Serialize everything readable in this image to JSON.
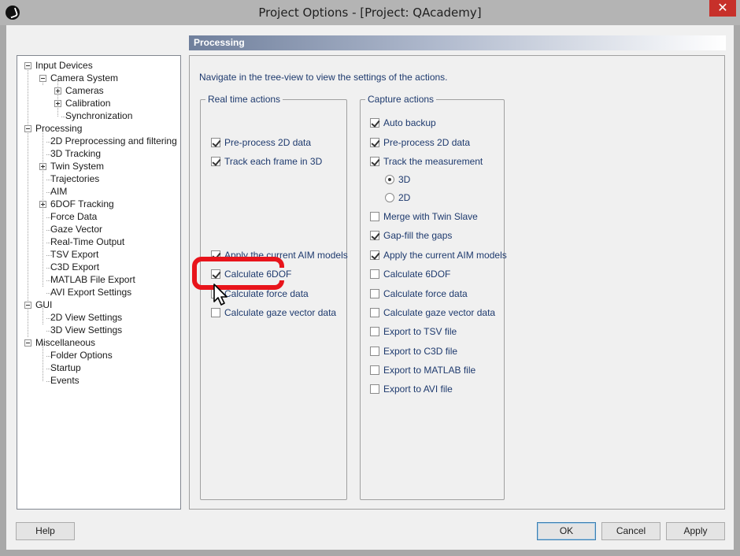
{
  "window": {
    "title": "Project Options - [Project: QAcademy]",
    "close_glyph": "✕"
  },
  "tree": {
    "items": [
      {
        "label": "Input Devices",
        "depth": 0,
        "expander": "minus"
      },
      {
        "label": "Camera System",
        "depth": 1,
        "expander": "minus"
      },
      {
        "label": "Cameras",
        "depth": 2,
        "expander": "plus"
      },
      {
        "label": "Calibration",
        "depth": 2,
        "expander": "plus"
      },
      {
        "label": "Synchronization",
        "depth": 2,
        "expander": "none"
      },
      {
        "label": "Processing",
        "depth": 0,
        "expander": "minus"
      },
      {
        "label": "2D Preprocessing and filtering",
        "depth": 1,
        "expander": "none"
      },
      {
        "label": "3D Tracking",
        "depth": 1,
        "expander": "none"
      },
      {
        "label": "Twin System",
        "depth": 1,
        "expander": "plus"
      },
      {
        "label": "Trajectories",
        "depth": 1,
        "expander": "none"
      },
      {
        "label": "AIM",
        "depth": 1,
        "expander": "none"
      },
      {
        "label": "6DOF Tracking",
        "depth": 1,
        "expander": "plus"
      },
      {
        "label": "Force Data",
        "depth": 1,
        "expander": "none"
      },
      {
        "label": "Gaze Vector",
        "depth": 1,
        "expander": "none"
      },
      {
        "label": "Real-Time Output",
        "depth": 1,
        "expander": "none"
      },
      {
        "label": "TSV Export",
        "depth": 1,
        "expander": "none"
      },
      {
        "label": "C3D Export",
        "depth": 1,
        "expander": "none"
      },
      {
        "label": "MATLAB File Export",
        "depth": 1,
        "expander": "none"
      },
      {
        "label": "AVI Export Settings",
        "depth": 1,
        "expander": "none"
      },
      {
        "label": "GUI",
        "depth": 0,
        "expander": "minus"
      },
      {
        "label": "2D View Settings",
        "depth": 1,
        "expander": "none"
      },
      {
        "label": "3D View Settings",
        "depth": 1,
        "expander": "none"
      },
      {
        "label": "Miscellaneous",
        "depth": 0,
        "expander": "minus"
      },
      {
        "label": "Folder Options",
        "depth": 1,
        "expander": "none"
      },
      {
        "label": "Startup",
        "depth": 1,
        "expander": "none"
      },
      {
        "label": "Events",
        "depth": 1,
        "expander": "none"
      }
    ]
  },
  "panel": {
    "header": "Processing",
    "hint": "Navigate in the tree-view to view the settings of the actions."
  },
  "realtime": {
    "legend": "Real time actions",
    "items": [
      {
        "label": "Pre-process 2D data",
        "checked": true
      },
      {
        "label": "Track each frame in 3D",
        "checked": true
      },
      {
        "label": "Apply the current AIM models",
        "checked": true
      },
      {
        "label": "Calculate 6DOF",
        "checked": true
      },
      {
        "label": "Calculate force data",
        "checked": false
      },
      {
        "label": "Calculate gaze vector data",
        "checked": false
      }
    ]
  },
  "capture": {
    "legend": "Capture actions",
    "items": [
      {
        "label": "Auto backup",
        "checked": true
      },
      {
        "label": "Pre-process 2D data",
        "checked": true
      },
      {
        "label": "Track the measurement",
        "checked": true
      },
      {
        "label": "Merge with Twin Slave",
        "checked": false
      },
      {
        "label": "Gap-fill the gaps",
        "checked": true
      },
      {
        "label": "Apply the current AIM models",
        "checked": true
      },
      {
        "label": "Calculate 6DOF",
        "checked": false
      },
      {
        "label": "Calculate force data",
        "checked": false
      },
      {
        "label": "Calculate gaze vector data",
        "checked": false
      },
      {
        "label": "Export to TSV file",
        "checked": false
      },
      {
        "label": "Export to C3D file",
        "checked": false
      },
      {
        "label": "Export to MATLAB file",
        "checked": false
      },
      {
        "label": "Export to AVI file",
        "checked": false
      }
    ],
    "radios": [
      {
        "label": "3D",
        "checked": true
      },
      {
        "label": "2D",
        "checked": false
      }
    ]
  },
  "buttons": {
    "help": "Help",
    "ok": "OK",
    "cancel": "Cancel",
    "apply": "Apply"
  },
  "colors": {
    "highlight": "#e8141b",
    "close": "#c7302a",
    "label_text": "#1e3a6e"
  }
}
